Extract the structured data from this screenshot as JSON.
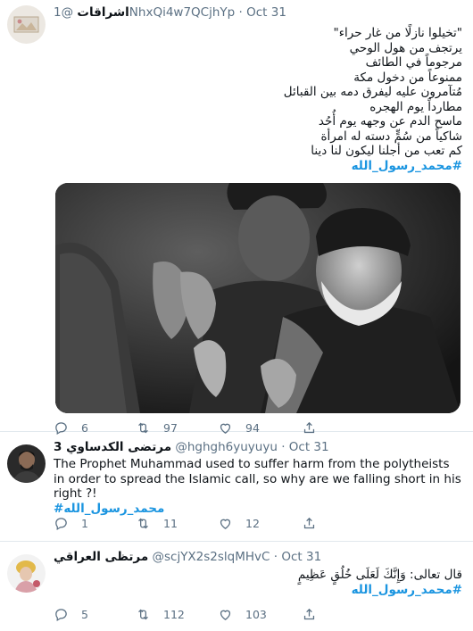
{
  "tweets": [
    {
      "name": "اشراقات",
      "handle": "@1NhxQi4w7QCjhYp",
      "separator": "·",
      "date": "Oct 31",
      "lines": [
        "\"تخيلوا نازلًا من غار حراء\"",
        "يرتجف من هول الوحي",
        "مرجوماً في الطائف",
        "ممنوعاً من دخول مكة",
        "مُتآمرون عليه ليفرق دمه بين القبائل",
        "مطارداً يوم الهجره",
        "ماسح الدم عن وجهه يوم أُحُد",
        "شاكياً من سُمٍّ دسته له امرأة",
        "كم تعب من أجلنا ليكون لنا دينا"
      ],
      "hashtag": "#محمد_رسول_الله",
      "replies": "6",
      "retweets": "97",
      "likes": "94"
    },
    {
      "name": "مرتضى الكدساوي 3",
      "handle": "@hghgh6yuyuyu",
      "separator": "·",
      "date": "Oct 31",
      "text": "The Prophet Muhammad used to suffer harm from the polytheists in order to spread the Islamic call, so why are we falling short in his right ?!",
      "hashtag": "#محمد_رسول_الله",
      "replies": "1",
      "retweets": "11",
      "likes": "12"
    },
    {
      "name": "مرتظى العراقي",
      "handle": "@scjYX2s2slqMHvC",
      "separator": "·",
      "date": "Oct 31",
      "text": "قال تعالى: وَإِنَّكَ لَعَلَى خُلُقٍ عَظِيمٍ",
      "hashtag": "#محمد_رسول_الله",
      "replies": "5",
      "retweets": "112",
      "likes": "103"
    }
  ],
  "icons": {
    "reply": "reply-icon",
    "retweet": "retweet-icon",
    "like": "like-icon",
    "share": "share-icon"
  },
  "colors": {
    "hashtag": "#1b95e0",
    "secondary_text": "#5b7083",
    "divider": "#e1e8ed"
  }
}
